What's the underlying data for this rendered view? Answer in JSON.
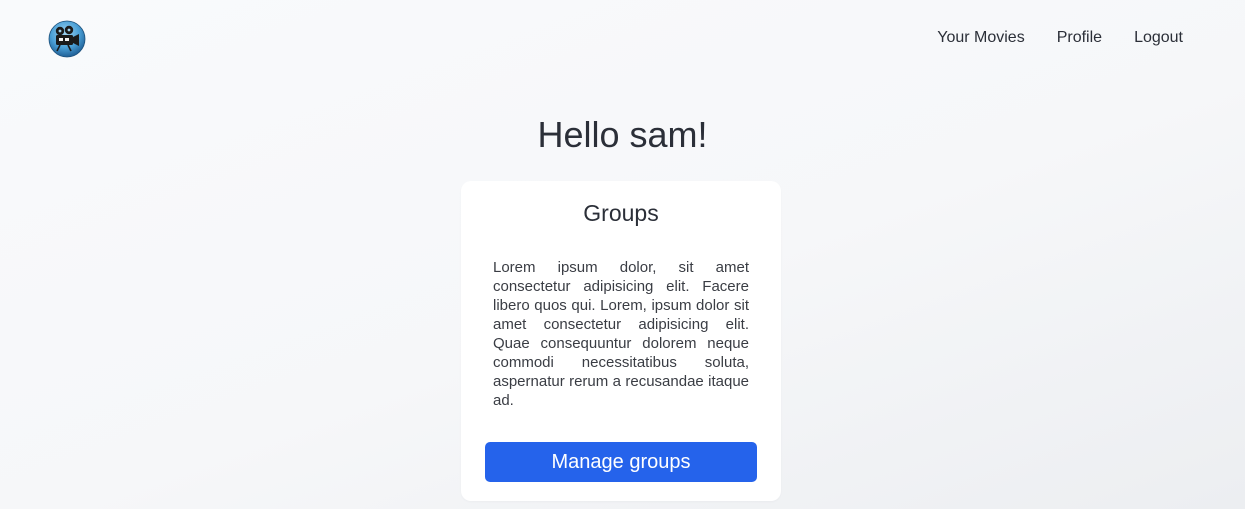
{
  "nav": {
    "logo_icon": "film-camera-logo-icon",
    "items": [
      {
        "label": "Your Movies"
      },
      {
        "label": "Profile"
      },
      {
        "label": "Logout"
      }
    ]
  },
  "main": {
    "greeting": "Hello sam!",
    "card": {
      "title": "Groups",
      "description": "Lorem ipsum dolor, sit amet consectetur adipisicing elit. Facere libero quos qui. Lorem, ipsum dolor sit amet consectetur adipisicing elit. Quae consequuntur dolorem neque commodi necessitatibus soluta, aspernatur rerum a recusandae itaque ad.",
      "button_label": "Manage groups"
    }
  },
  "colors": {
    "primary_button": "#2563eb",
    "text": "#2b2f38",
    "card_background": "#ffffff"
  }
}
